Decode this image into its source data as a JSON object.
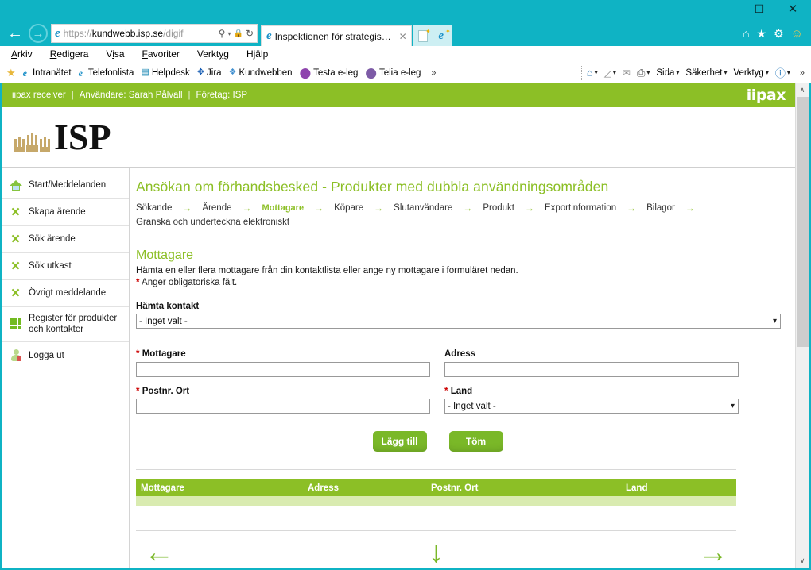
{
  "window": {
    "minimize_label": "–",
    "maximize_label": "☐",
    "close_label": "✕"
  },
  "browser": {
    "back_glyph": "←",
    "forward_glyph": "→",
    "url_scheme": "https://",
    "url_host": "kundwebb.isp.se",
    "url_path": "/digif",
    "search_icon": "⚲",
    "lock_icon": "🔒",
    "refresh_icon": "↻",
    "dropdown_caret": "▾",
    "tab_title": "Inspektionen för strategiska...",
    "tab_close": "✕",
    "right_icons": [
      "home-icon",
      "favorites-star-icon",
      "settings-gear-icon",
      "feedback-smiley-icon"
    ],
    "home_glyph": "⌂",
    "star_glyph": "★",
    "gear_glyph": "⚙",
    "smiley_glyph": "☺"
  },
  "menubar": {
    "items": [
      {
        "pre": "",
        "accel": "A",
        "post": "rkiv"
      },
      {
        "pre": "",
        "accel": "R",
        "post": "edigera"
      },
      {
        "pre": "V",
        "accel": "i",
        "post": "sa"
      },
      {
        "pre": "",
        "accel": "F",
        "post": "avoriter"
      },
      {
        "pre": "Verkt",
        "accel": "y",
        "post": "g"
      },
      {
        "pre": "H",
        "accel": "j",
        "post": "älp"
      }
    ]
  },
  "favorites_bar": {
    "add_icon": "☆",
    "items": [
      {
        "label": "Intranätet",
        "icon": "ie-icon"
      },
      {
        "label": "Telefonlista",
        "icon": "ie-icon"
      },
      {
        "label": "Helpdesk",
        "icon": "helpdesk-icon"
      },
      {
        "label": "Jira",
        "icon": "jira-icon"
      },
      {
        "label": "Kundwebben",
        "icon": "kundwebben-icon"
      },
      {
        "label": "Testa e-leg",
        "icon": "eleg-icon"
      },
      {
        "label": "Telia e-leg",
        "icon": "telia-icon"
      }
    ],
    "overflow": "»",
    "command_bar": [
      {
        "label": "",
        "icon": "home-icon",
        "caret": true
      },
      {
        "label": "",
        "icon": "feeds-icon",
        "caret": true
      },
      {
        "label": "",
        "icon": "mail-icon",
        "caret": false
      },
      {
        "label": "",
        "icon": "print-icon",
        "caret": true
      },
      {
        "label": "Sida",
        "icon": "",
        "caret": true
      },
      {
        "label": "Säkerhet",
        "icon": "",
        "caret": true
      },
      {
        "label": "Verktyg",
        "icon": "",
        "caret": true
      },
      {
        "label": "",
        "icon": "help-icon",
        "caret": true
      }
    ],
    "command_overflow": "»"
  },
  "app_header": {
    "product": "iipax receiver",
    "user_label": "Användare: Sarah Pålvall",
    "company_label": "Företag: ISP",
    "separator": "|",
    "brand": "iipax",
    "bar_color": "#8cbf26"
  },
  "logo": {
    "text": "ISP",
    "crown_color": "#c6a86a"
  },
  "sidebar": {
    "items": [
      {
        "label": "Start/Meddelanden",
        "icon": "home-icon"
      },
      {
        "label": "Skapa ärende",
        "icon": "x-mark-icon"
      },
      {
        "label": "Sök ärende",
        "icon": "x-mark-icon"
      },
      {
        "label": "Sök utkast",
        "icon": "x-mark-icon"
      },
      {
        "label": "Övrigt meddelande",
        "icon": "x-mark-icon"
      },
      {
        "label": "Register för produkter och kontakter",
        "icon": "grid-icon"
      },
      {
        "label": "Logga ut",
        "icon": "logout-user-icon"
      }
    ]
  },
  "main": {
    "page_title": "Ansökan om förhandsbesked - Produkter med dubbla användningsområden",
    "steps": [
      {
        "label": "Sökande",
        "active": false
      },
      {
        "label": "Ärende",
        "active": false
      },
      {
        "label": "Mottagare",
        "active": true
      },
      {
        "label": "Köpare",
        "active": false
      },
      {
        "label": "Slutanvändare",
        "active": false
      },
      {
        "label": "Produkt",
        "active": false
      },
      {
        "label": "Exportinformation",
        "active": false
      },
      {
        "label": "Bilagor",
        "active": false
      },
      {
        "label": "Granska och underteckna elektroniskt",
        "active": false
      }
    ],
    "step_arrow": "→",
    "section_title": "Mottagare",
    "lead_text": "Hämta en eller flera mottagare från din kontaktlista eller ange ny mottagare i formuläret nedan.",
    "required_note": "Anger obligatoriska fält.",
    "asterisk": "*",
    "contact_picker": {
      "label": "Hämta kontakt",
      "value": "- Inget valt -",
      "caret": "⌄"
    },
    "fields": {
      "mottagare": {
        "label": "Mottagare",
        "required": true,
        "value": "",
        "placeholder": ""
      },
      "adress": {
        "label": "Adress",
        "required": false,
        "value": "",
        "placeholder": ""
      },
      "postnr_ort": {
        "label": "Postnr. Ort",
        "required": true,
        "value": "",
        "placeholder": ""
      },
      "land": {
        "label": "Land",
        "required": true,
        "value": "- Inget valt -",
        "caret": "⌄"
      }
    },
    "buttons": {
      "add": "Lägg till",
      "clear": "Töm"
    },
    "table": {
      "columns": [
        "Mottagare",
        "Adress",
        "Postnr. Ort",
        "Land"
      ],
      "rows": []
    },
    "footer_nav": {
      "back": "←",
      "save": "↓",
      "next": "→"
    }
  },
  "scrollbar": {
    "up_arrow": "∧",
    "down_arrow": "∨"
  }
}
